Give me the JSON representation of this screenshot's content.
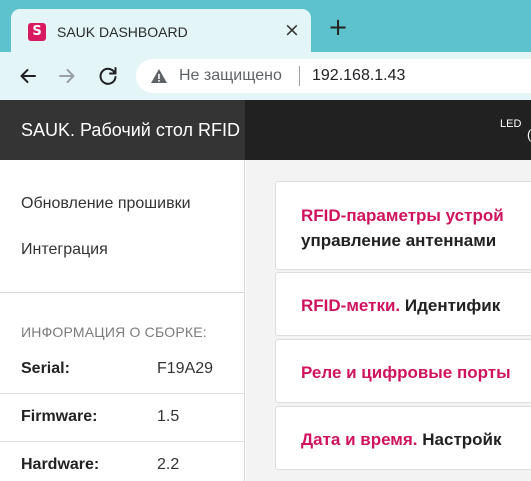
{
  "browser": {
    "favicon_letter": "S",
    "tab_title": "SAUK DASHBOARD",
    "close_symbol": "×",
    "new_tab_symbol": "+",
    "security_text": "Не защищено",
    "url": "192.168.1.43",
    "accent_color": "#5ec2cc",
    "favicon_color": "#d81b60"
  },
  "appbar": {
    "title": "SAUK. Рабочий стол RFID",
    "led_label": "LED",
    "led_paren": "("
  },
  "sidebar": {
    "menu": [
      {
        "label": "Обновление прошивки"
      },
      {
        "label": "Интеграция"
      }
    ],
    "build_info": {
      "heading": "ИНФОРМАЦИЯ О СБОРКЕ:",
      "rows": [
        {
          "label": "Serial:",
          "value": "F19A29"
        },
        {
          "label": "Firmware:",
          "value": "1.5"
        },
        {
          "label": "Hardware:",
          "value": "2.2"
        }
      ]
    }
  },
  "cards": [
    {
      "title": "RFID-параметры устрой",
      "subtitle": "управление антеннами"
    },
    {
      "title": "RFID-метки.",
      "rest": " Идентифик"
    },
    {
      "title": "Реле и цифровые порты"
    },
    {
      "title": "Дата и время.",
      "rest": " Настройк"
    }
  ],
  "colors": {
    "card_accent": "#d0135e",
    "appbar_bg": "#212121"
  }
}
